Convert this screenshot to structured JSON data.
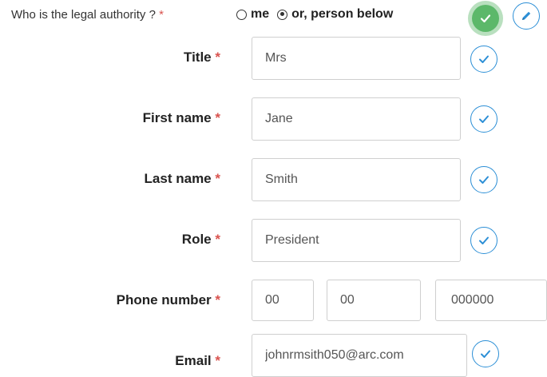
{
  "question": {
    "label": "Who is the legal authority ?",
    "required_mark": "*",
    "options": [
      {
        "label": "me",
        "checked": false
      },
      {
        "label": "or, person below",
        "checked": true
      }
    ]
  },
  "fields": {
    "title": {
      "label": "Title",
      "required_mark": "*",
      "value": "Mrs"
    },
    "first_name": {
      "label": "First name",
      "required_mark": "*",
      "value": "Jane"
    },
    "last_name": {
      "label": "Last name",
      "required_mark": "*",
      "value": "Smith"
    },
    "role": {
      "label": "Role",
      "required_mark": "*",
      "value": "President"
    },
    "phone": {
      "label": "Phone number",
      "required_mark": "*",
      "parts": [
        "00",
        "00",
        "000000"
      ]
    },
    "email": {
      "label": "Email",
      "required_mark": "*",
      "value": "johnrmsith050@arc.com"
    }
  },
  "icons": {
    "confirm": "check-circle-icon",
    "edit": "pencil-icon",
    "validate": "check-icon"
  },
  "colors": {
    "required": "#d9534f",
    "confirm_green": "#5cb86a",
    "accent_blue": "#2c8fd6"
  }
}
